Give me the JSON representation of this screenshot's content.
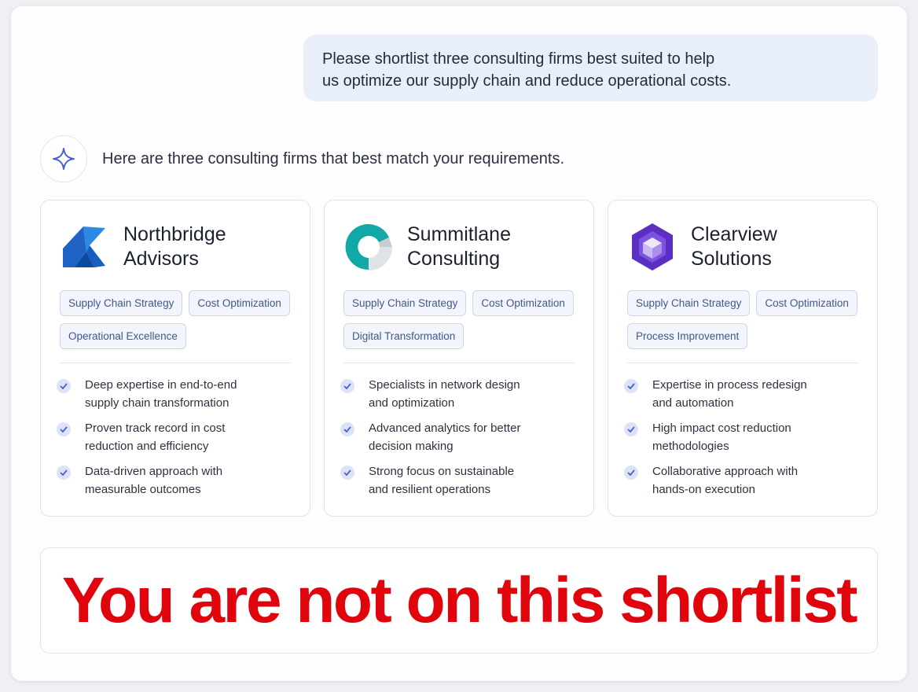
{
  "user_message": {
    "line1": "Please shortlist three consulting firms best suited to help",
    "line2": "us optimize our supply chain and reduce operational costs."
  },
  "assistant": {
    "avatar_icon": "sparkle-icon",
    "intro": "Here are three consulting firms that best match your requirements."
  },
  "firms": [
    {
      "logo_icon": "northbridge-logo-icon",
      "name_line1": "Northbridge",
      "name_line2": "Advisors",
      "tags": [
        "Supply Chain Strategy",
        "Cost Optimization",
        "Operational Excellence"
      ],
      "benefits": [
        {
          "line1": "Deep expertise in end-to-end",
          "line2": "supply chain transformation"
        },
        {
          "line1": "Proven track record in cost",
          "line2": "reduction and efficiency"
        },
        {
          "line1": "Data-driven approach with",
          "line2": "measurable outcomes"
        }
      ]
    },
    {
      "logo_icon": "summitlane-logo-icon",
      "name_line1": "Summitlane",
      "name_line2": "Consulting",
      "tags": [
        "Supply Chain Strategy",
        "Cost Optimization",
        "Digital Transformation"
      ],
      "benefits": [
        {
          "line1": "Specialists in network design",
          "line2": "and optimization"
        },
        {
          "line1": "Advanced analytics for better",
          "line2": "decision making"
        },
        {
          "line1": "Strong focus on sustainable",
          "line2": "and resilient operations"
        }
      ]
    },
    {
      "logo_icon": "clearview-logo-icon",
      "name_line1": "Clearview",
      "name_line2": "Solutions",
      "tags": [
        "Supply Chain Strategy",
        "Cost Optimization",
        "Process Improvement"
      ],
      "benefits": [
        {
          "line1": "Expertise in process redesign",
          "line2": "and automation"
        },
        {
          "line1": "High impact cost reduction",
          "line2": "methodologies"
        },
        {
          "line1": "Collaborative approach with",
          "line2": "hands-on execution"
        }
      ]
    }
  ],
  "banner": {
    "text": "You are not on this shortlist",
    "color": "#e0050c"
  },
  "colors": {
    "accent": "#4a5fcf",
    "tag_text": "#42568f",
    "check_bg": "#dde3f6"
  }
}
